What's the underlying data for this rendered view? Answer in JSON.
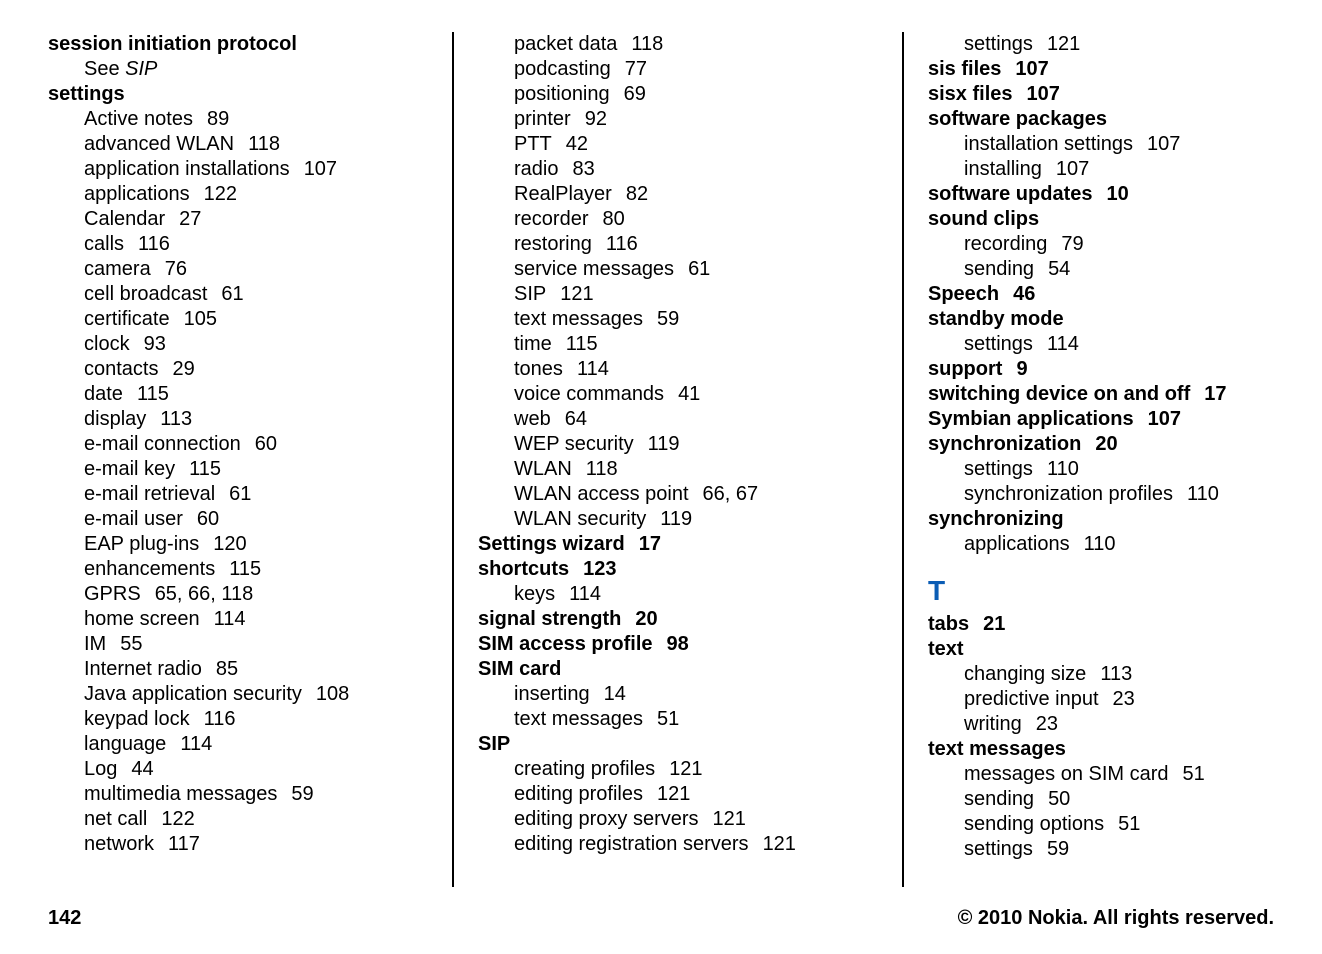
{
  "columns": [
    [
      {
        "type": "head",
        "text": "session initiation protocol"
      },
      {
        "type": "sub",
        "prefix": "See ",
        "italic": "SIP"
      },
      {
        "type": "head",
        "text": "settings"
      },
      {
        "type": "sub",
        "text": "Active notes",
        "pages": "89"
      },
      {
        "type": "sub",
        "text": "advanced WLAN",
        "pages": "118"
      },
      {
        "type": "sub",
        "text": "application installations",
        "pages": "107"
      },
      {
        "type": "sub",
        "text": "applications",
        "pages": "122"
      },
      {
        "type": "sub",
        "text": "Calendar",
        "pages": "27"
      },
      {
        "type": "sub",
        "text": "calls",
        "pages": "116"
      },
      {
        "type": "sub",
        "text": "camera",
        "pages": "76"
      },
      {
        "type": "sub",
        "text": "cell broadcast",
        "pages": "61"
      },
      {
        "type": "sub",
        "text": "certificate",
        "pages": "105"
      },
      {
        "type": "sub",
        "text": "clock",
        "pages": "93"
      },
      {
        "type": "sub",
        "text": "contacts",
        "pages": "29"
      },
      {
        "type": "sub",
        "text": "date",
        "pages": "115"
      },
      {
        "type": "sub",
        "text": "display",
        "pages": "113"
      },
      {
        "type": "sub",
        "text": "e-mail connection",
        "pages": "60"
      },
      {
        "type": "sub",
        "text": "e-mail key",
        "pages": "115"
      },
      {
        "type": "sub",
        "text": "e-mail retrieval",
        "pages": "61"
      },
      {
        "type": "sub",
        "text": "e-mail user",
        "pages": "60"
      },
      {
        "type": "sub",
        "text": "EAP plug-ins",
        "pages": "120"
      },
      {
        "type": "sub",
        "text": "enhancements",
        "pages": "115"
      },
      {
        "type": "sub",
        "text": "GPRS",
        "pages": "65, 66, 118"
      },
      {
        "type": "sub",
        "text": "home screen",
        "pages": "114"
      },
      {
        "type": "sub",
        "text": "IM",
        "pages": "55"
      },
      {
        "type": "sub",
        "text": "Internet radio",
        "pages": "85"
      },
      {
        "type": "sub",
        "text": "Java application security",
        "pages": "108"
      },
      {
        "type": "sub",
        "text": "keypad lock",
        "pages": "116"
      },
      {
        "type": "sub",
        "text": "language",
        "pages": "114"
      },
      {
        "type": "sub",
        "text": "Log",
        "pages": "44"
      },
      {
        "type": "sub",
        "text": "multimedia messages",
        "pages": "59"
      },
      {
        "type": "sub",
        "text": "net call",
        "pages": "122"
      },
      {
        "type": "sub",
        "text": "network",
        "pages": "117"
      }
    ],
    [
      {
        "type": "sub",
        "text": "packet data",
        "pages": "118"
      },
      {
        "type": "sub",
        "text": "podcasting",
        "pages": "77"
      },
      {
        "type": "sub",
        "text": "positioning",
        "pages": "69"
      },
      {
        "type": "sub",
        "text": "printer",
        "pages": "92"
      },
      {
        "type": "sub",
        "text": "PTT",
        "pages": "42"
      },
      {
        "type": "sub",
        "text": "radio",
        "pages": "83"
      },
      {
        "type": "sub",
        "text": "RealPlayer",
        "pages": "82"
      },
      {
        "type": "sub",
        "text": "recorder",
        "pages": "80"
      },
      {
        "type": "sub",
        "text": "restoring",
        "pages": "116"
      },
      {
        "type": "sub",
        "text": "service messages",
        "pages": "61"
      },
      {
        "type": "sub",
        "text": "SIP",
        "pages": "121"
      },
      {
        "type": "sub",
        "text": "text messages",
        "pages": "59"
      },
      {
        "type": "sub",
        "text": "time",
        "pages": "115"
      },
      {
        "type": "sub",
        "text": "tones",
        "pages": "114"
      },
      {
        "type": "sub",
        "text": "voice commands",
        "pages": "41"
      },
      {
        "type": "sub",
        "text": "web",
        "pages": "64"
      },
      {
        "type": "sub",
        "text": "WEP security",
        "pages": "119"
      },
      {
        "type": "sub",
        "text": "WLAN",
        "pages": "118"
      },
      {
        "type": "sub",
        "text": "WLAN access point",
        "pages": "66, 67"
      },
      {
        "type": "sub",
        "text": "WLAN security",
        "pages": "119"
      },
      {
        "type": "head",
        "text": "Settings wizard",
        "pages": "17"
      },
      {
        "type": "head",
        "text": "shortcuts",
        "pages": "123"
      },
      {
        "type": "sub",
        "text": "keys",
        "pages": "114"
      },
      {
        "type": "head",
        "text": "signal strength",
        "pages": "20"
      },
      {
        "type": "head",
        "text": "SIM access profile",
        "pages": "98"
      },
      {
        "type": "head",
        "text": "SIM card"
      },
      {
        "type": "sub",
        "text": "inserting",
        "pages": "14"
      },
      {
        "type": "sub",
        "text": "text messages",
        "pages": "51"
      },
      {
        "type": "head",
        "text": "SIP"
      },
      {
        "type": "sub",
        "text": "creating profiles",
        "pages": "121"
      },
      {
        "type": "sub",
        "text": "editing profiles",
        "pages": "121"
      },
      {
        "type": "sub",
        "text": "editing proxy servers",
        "pages": "121"
      },
      {
        "type": "sub",
        "text": "editing registration servers",
        "pages": "121"
      }
    ],
    [
      {
        "type": "sub",
        "text": "settings",
        "pages": "121"
      },
      {
        "type": "head",
        "text": "sis files",
        "pages": "107"
      },
      {
        "type": "head",
        "text": "sisx files",
        "pages": "107"
      },
      {
        "type": "head",
        "text": "software packages"
      },
      {
        "type": "sub",
        "text": "installation settings",
        "pages": "107"
      },
      {
        "type": "sub",
        "text": "installing",
        "pages": "107"
      },
      {
        "type": "head",
        "text": "software updates",
        "pages": "10"
      },
      {
        "type": "head",
        "text": "sound clips"
      },
      {
        "type": "sub",
        "text": "recording",
        "pages": "79"
      },
      {
        "type": "sub",
        "text": "sending",
        "pages": "54"
      },
      {
        "type": "head",
        "text": "Speech",
        "pages": "46"
      },
      {
        "type": "head",
        "text": "standby mode"
      },
      {
        "type": "sub",
        "text": "settings",
        "pages": "114"
      },
      {
        "type": "head",
        "text": "support",
        "pages": "9"
      },
      {
        "type": "head",
        "text": "switching device on and off",
        "pages": "17"
      },
      {
        "type": "head",
        "text": "Symbian applications",
        "pages": "107"
      },
      {
        "type": "head",
        "text": "synchronization",
        "pages": "20"
      },
      {
        "type": "sub",
        "text": "settings",
        "pages": "110"
      },
      {
        "type": "sub",
        "text": "synchronization profiles",
        "pages": "110"
      },
      {
        "type": "head",
        "text": "synchronizing"
      },
      {
        "type": "sub",
        "text": "applications",
        "pages": "110"
      },
      {
        "type": "letter",
        "text": "T"
      },
      {
        "type": "head",
        "text": "tabs",
        "pages": "21"
      },
      {
        "type": "head",
        "text": "text"
      },
      {
        "type": "sub",
        "text": "changing size",
        "pages": "113"
      },
      {
        "type": "sub",
        "text": "predictive input",
        "pages": "23"
      },
      {
        "type": "sub",
        "text": "writing",
        "pages": "23"
      },
      {
        "type": "head",
        "text": "text messages"
      },
      {
        "type": "sub",
        "text": "messages on SIM card",
        "pages": "51"
      },
      {
        "type": "sub",
        "text": "sending",
        "pages": "50"
      },
      {
        "type": "sub",
        "text": "sending options",
        "pages": "51"
      },
      {
        "type": "sub",
        "text": "settings",
        "pages": "59"
      }
    ]
  ],
  "footer": {
    "page": "142",
    "copyright": "© 2010 Nokia. All rights reserved."
  }
}
